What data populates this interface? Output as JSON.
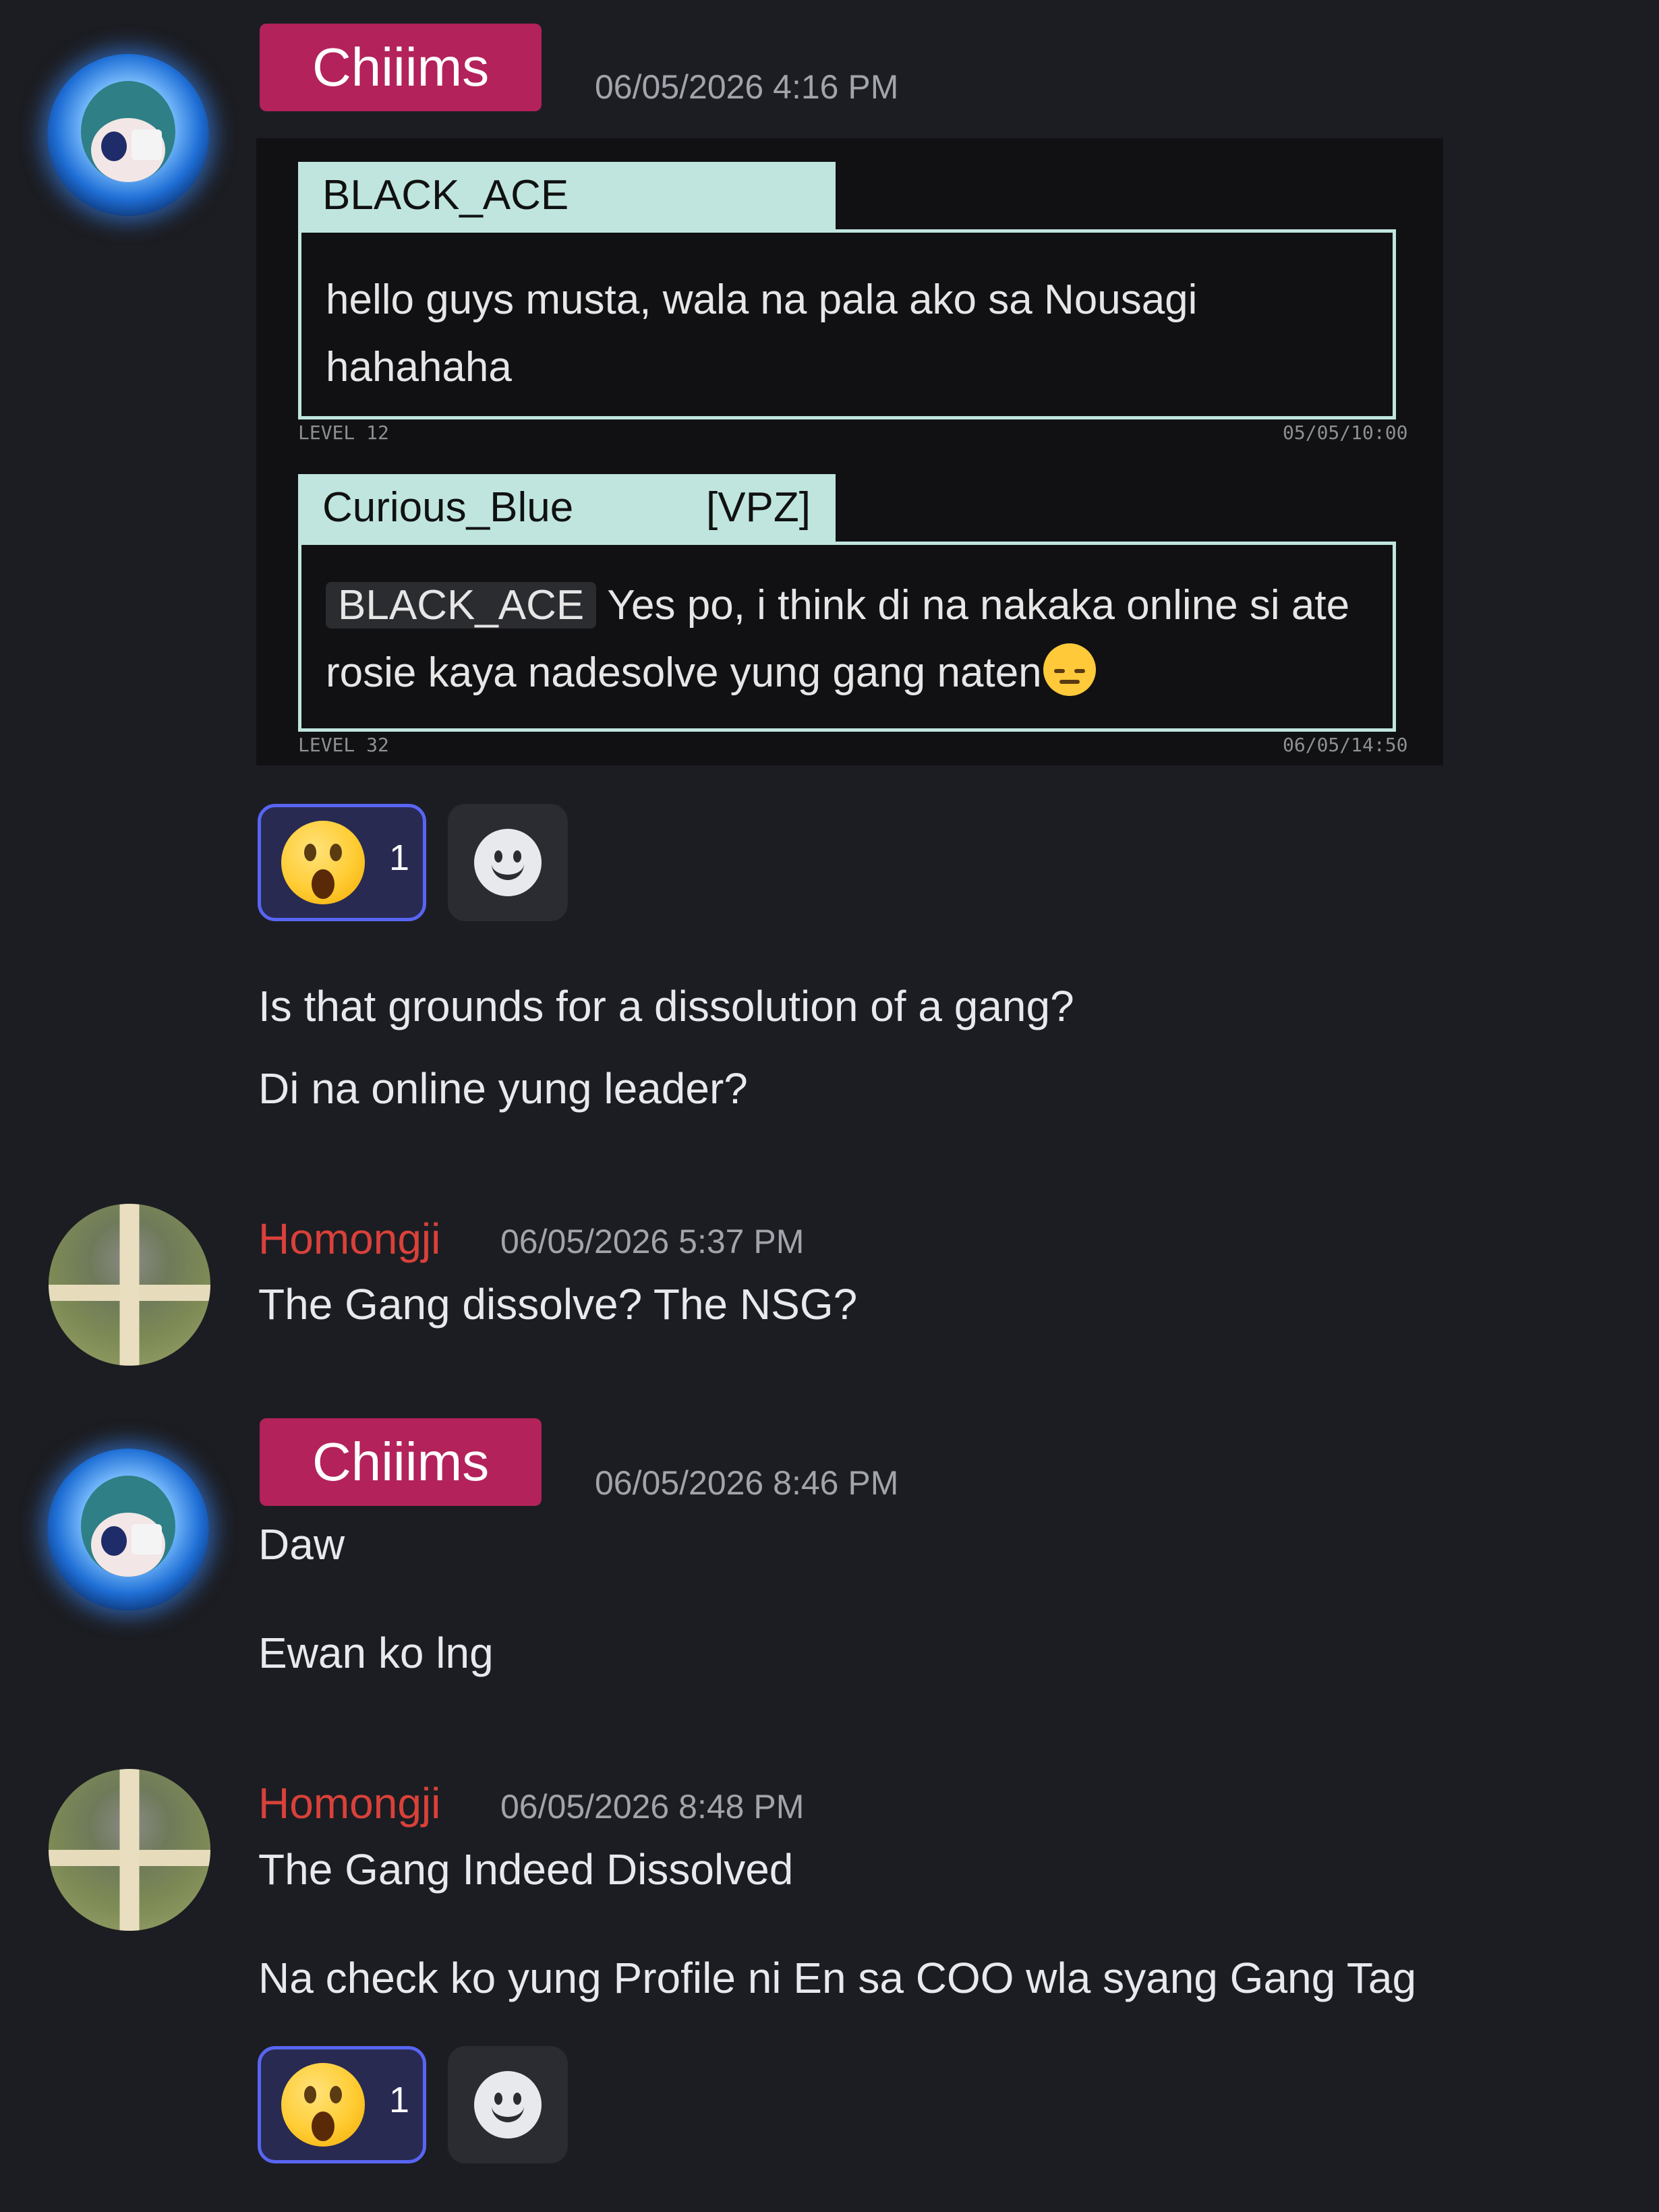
{
  "messages": {
    "m1": {
      "author": "Chiiims",
      "timestamp": "06/05/2026 4:16 PM",
      "embed": {
        "card1": {
          "user": "BLACK_ACE",
          "line1": "hello guys musta, wala na pala ako sa Nousagi",
          "line2": "hahahaha",
          "level": "LEVEL 12",
          "time": "05/05/10:00"
        },
        "card2": {
          "user": "Curious_Blue",
          "tag": "[VPZ]",
          "mention": "BLACK_ACE",
          "line1": "Yes po, i think di na nakaka online si ate",
          "line2": "rosie kaya nadesolve yung gang naten",
          "line2_emoji": "disappointed-face",
          "level": "LEVEL 32",
          "time": "06/05/14:50"
        }
      },
      "reaction": {
        "emoji": "astonished-face",
        "count": "1"
      },
      "followups": [
        "Is that grounds for a dissolution of a gang?",
        "Di na online yung leader?"
      ]
    },
    "m2": {
      "author": "Homongji",
      "timestamp": "06/05/2026 5:37 PM",
      "text": "The Gang dissolve? The NSG?"
    },
    "m3": {
      "author": "Chiiims",
      "timestamp": "06/05/2026 8:46 PM",
      "lines": [
        "Daw",
        "Ewan ko lng"
      ]
    },
    "m4": {
      "author": "Homongji",
      "timestamp": "06/05/2026 8:48 PM",
      "lines": [
        "The Gang Indeed Dissolved",
        "Na check ko yung Profile ni En sa COO wla syang Gang Tag"
      ],
      "reaction": {
        "emoji": "astonished-face",
        "count": "1"
      }
    }
  },
  "colors": {
    "background": "#1c1d22",
    "role_tag": "#b3225b",
    "homongji_name": "#d9413a",
    "reaction_border": "#5865f2",
    "card_accent": "#bfe5de"
  },
  "icons": {
    "add_reaction": "add-reaction-smile-icon"
  }
}
